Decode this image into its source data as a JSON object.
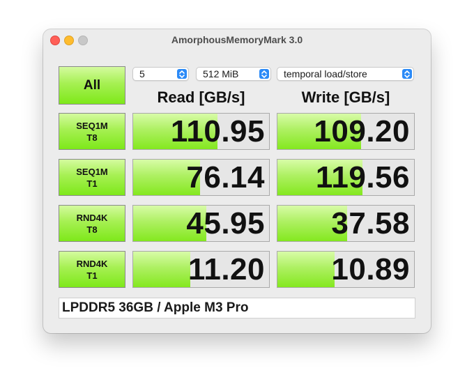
{
  "window": {
    "title": "AmorphousMemoryMark 3.0"
  },
  "controls": {
    "all_label": "All",
    "count": "5",
    "size": "512 MiB",
    "mode": "temporal load/store"
  },
  "headers": {
    "read": "Read [GB/s]",
    "write": "Write [GB/s]"
  },
  "rows": [
    {
      "line1": "SEQ1M",
      "line2": "T8",
      "read": "110.95",
      "write": "109.20",
      "read_fill": 0.62,
      "write_fill": 0.61
    },
    {
      "line1": "SEQ1M",
      "line2": "T1",
      "read": "76.14",
      "write": "119.56",
      "read_fill": 0.49,
      "write_fill": 0.62
    },
    {
      "line1": "RND4K",
      "line2": "T8",
      "read": "45.95",
      "write": "37.58",
      "read_fill": 0.54,
      "write_fill": 0.51
    },
    {
      "line1": "RND4K",
      "line2": "T1",
      "read": "11.20",
      "write": "10.89",
      "read_fill": 0.42,
      "write_fill": 0.42
    }
  ],
  "info_text": "LPDDR5 36GB / Apple M3 Pro",
  "colors": {
    "accent": "#2b8af7",
    "bar_green": "#84e81f"
  }
}
